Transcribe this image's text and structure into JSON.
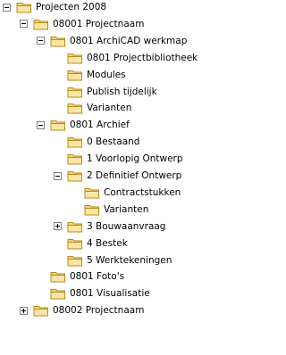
{
  "tree": {
    "icons": {
      "folder": "folder-icon",
      "expand": "plus-icon",
      "collapse": "minus-icon"
    },
    "colors": {
      "folder_fill": "#f6d67a",
      "folder_edge": "#b98b1a",
      "toggle_border": "#808080"
    },
    "nodes": [
      {
        "label": "Projecten 2008",
        "depth": 0,
        "state": "expanded"
      },
      {
        "label": "08001 Projectnaam",
        "depth": 1,
        "state": "expanded"
      },
      {
        "label": "0801 ArchiCAD werkmap",
        "depth": 2,
        "state": "expanded"
      },
      {
        "label": "0801 Projectbibliotheek",
        "depth": 3,
        "state": "leaf"
      },
      {
        "label": "Modules",
        "depth": 3,
        "state": "leaf"
      },
      {
        "label": "Publish tijdelijk",
        "depth": 3,
        "state": "leaf"
      },
      {
        "label": "Varianten",
        "depth": 3,
        "state": "leaf"
      },
      {
        "label": "0801 Archief",
        "depth": 2,
        "state": "expanded"
      },
      {
        "label": "0 Bestaand",
        "depth": 3,
        "state": "leaf"
      },
      {
        "label": "1 Voorlopig Ontwerp",
        "depth": 3,
        "state": "leaf"
      },
      {
        "label": "2 Definitief Ontwerp",
        "depth": 3,
        "state": "expanded"
      },
      {
        "label": "Contractstukken",
        "depth": 4,
        "state": "leaf"
      },
      {
        "label": "Varianten",
        "depth": 4,
        "state": "leaf"
      },
      {
        "label": "3 Bouwaanvraag",
        "depth": 3,
        "state": "collapsed"
      },
      {
        "label": "4 Bestek",
        "depth": 3,
        "state": "leaf"
      },
      {
        "label": "5 Werktekeningen",
        "depth": 3,
        "state": "leaf"
      },
      {
        "label": "0801 Foto's",
        "depth": 2,
        "state": "leaf"
      },
      {
        "label": "0801 Visualisatie",
        "depth": 2,
        "state": "leaf"
      },
      {
        "label": "08002 Projectnaam",
        "depth": 1,
        "state": "collapsed"
      }
    ]
  }
}
